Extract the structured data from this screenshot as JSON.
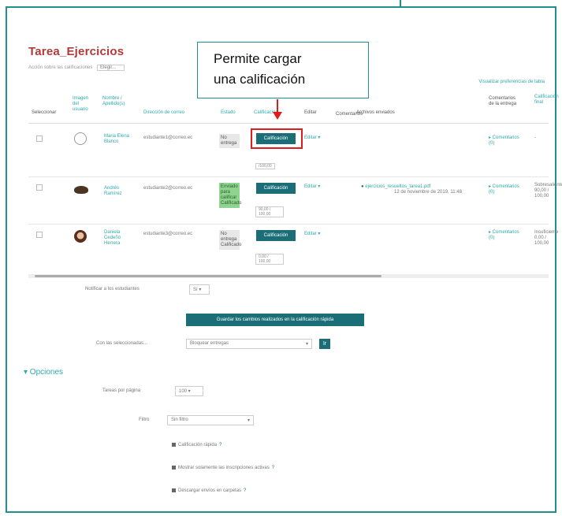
{
  "callout": {
    "line1": "Permite cargar",
    "line2": "una calificación"
  },
  "page": {
    "title": "Tarea_Ejercicios",
    "subline_label": "Acción sobre las calificaciones",
    "subline_value": "Elegir...",
    "top_right_link": "Visualizar preferencias de tabla"
  },
  "headers": {
    "select": "Seleccionar",
    "image": "Imagen del usuario",
    "name": "Nombre / Apellido(s)",
    "email": "Dirección de correo",
    "status": "Estado",
    "grade": "Calificación",
    "edit": "Editar",
    "comments": "Comentarios",
    "submitted": "Archivos enviados",
    "submission_comments": "Comentarios de la entrega",
    "final": "Calificación final"
  },
  "rows": [
    {
      "name": "Maria Elena Blanco",
      "email": "estudiante1@correo.ec",
      "status": "No entrega",
      "grade_button": "Calificación",
      "grade_value": "/100,00",
      "edit": "Editar ▾",
      "file": "",
      "comment_link": "▸ Comentarios (0)",
      "final": "-"
    },
    {
      "name": "Andrés Ramírez",
      "email": "estudiante2@correo.ec",
      "status": "Enviado para calificar Calificado",
      "grade_button": "Calificación",
      "grade_value": "90,00 / 100,00",
      "edit": "Editar ▾",
      "file": "ejercicios_resueltos_tarea1.pdf",
      "file_date": "12 de noviembre de 2019, 11:48",
      "comment_link": "▸ Comentarios (0)",
      "final": "Sobresaliente 90,00 / 100,00"
    },
    {
      "name": "Daniela Cedeño Herrera",
      "email": "estudiante3@correo.ec",
      "status": "No entrega Calificado",
      "grade_button": "Calificación",
      "grade_value": "0,00 / 100,00",
      "edit": "Editar ▾",
      "file": "",
      "comment_link": "▸ Comentarios (0)",
      "final": "Insuficiente 0,00 / 100,00"
    }
  ],
  "bulk": {
    "notify_label": "Notificar a los estudiantes",
    "notify_value": "Sí ▾",
    "save_button": "Guardar los cambios realizados en la calificación rápida",
    "with_selected_label": "Con las seleccionadas...",
    "with_selected_value": "Bloquear entregas",
    "go_button": "Ir"
  },
  "options": {
    "heading": "▾ Opciones",
    "per_page_label": "Tareas por página",
    "per_page_value": "100 ▾",
    "filter_label": "Filtro",
    "filter_value": "Sin filtro",
    "quick_grading": "Calificación rápida",
    "show_only_active": "Mostrar solamente las inscripciones activas",
    "download_files": "Descargar envíos en carpetas"
  },
  "colors": {
    "accent": "#1b6e78",
    "link": "#2ea9a9",
    "title": "#b03a3a",
    "highlight": "#e01b1b",
    "frame": "#1f8f8f"
  }
}
